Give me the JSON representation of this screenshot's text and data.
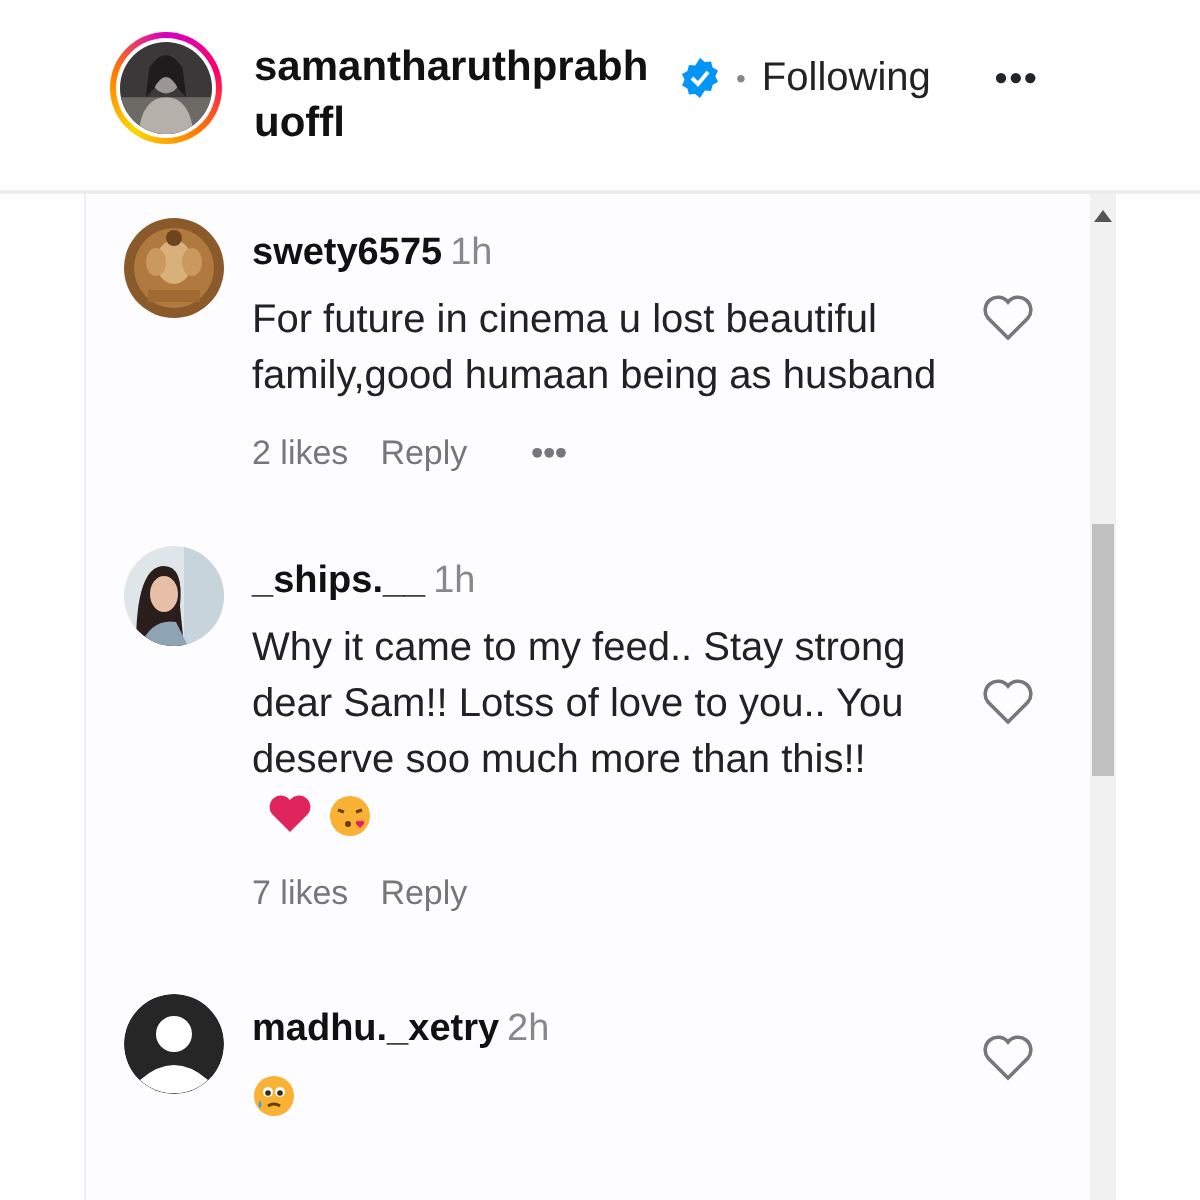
{
  "header": {
    "username": "samantharuthprabhuoffl",
    "verified": true,
    "separator": "•",
    "follow_label": "Following",
    "more": "•••",
    "story_ring": true
  },
  "comments": [
    {
      "avatar": {
        "kind": "picture"
      },
      "username": "swety6575",
      "time": "1h",
      "text": "For future in cinema u lost beautiful family,good humaan being as husband",
      "liked": false,
      "likes": "2 likes",
      "reply": "Reply",
      "more": "•••"
    },
    {
      "avatar": {
        "kind": "picture"
      },
      "username": "_ships.__",
      "time": "1h",
      "text": "Why it came to my feed.. Stay strong dear Sam!! Lotss of love to you.. You deserve soo much more than this!!",
      "emojis": [
        {
          "kind": "heart"
        },
        {
          "kind": "kiss"
        }
      ],
      "liked": false,
      "likes": "7 likes",
      "reply": "Reply"
    },
    {
      "avatar": {
        "kind": "default"
      },
      "username": "madhu._xetry",
      "time": "2h",
      "emojis": [
        {
          "kind": "teary"
        }
      ],
      "liked": false
    }
  ]
}
